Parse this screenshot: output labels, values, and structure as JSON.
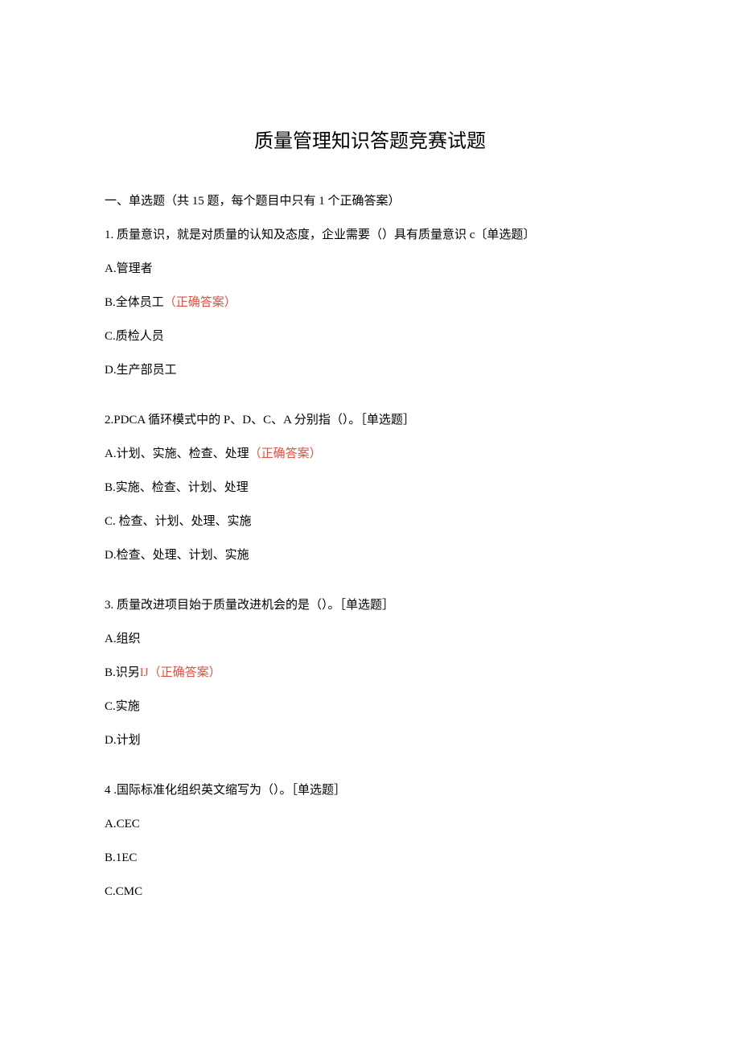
{
  "title": "质量管理知识答题竞赛试题",
  "section_header": "一、单选题（共 15 题，每个题目中只有 1 个正确答案）",
  "questions": [
    {
      "stem": "1. 质量意识，就是对质量的认知及态度，企业需要（）具有质量意识 c〔单选题〕",
      "options": [
        {
          "label": "A.管理者",
          "correct": false
        },
        {
          "label": "B.全体员工",
          "correct": true,
          "suffix": "（正确答案）"
        },
        {
          "label": "C.质检人员",
          "correct": false
        },
        {
          "label": "D.生产部员工",
          "correct": false
        }
      ]
    },
    {
      "stem": "2.PDCA 循环模式中的 P、D、C、A 分别指（）。［单选题］",
      "options": [
        {
          "label": "A.计划、实施、检查、处理",
          "correct": true,
          "suffix": "（正确答案）"
        },
        {
          "label": "B.实施、检查、计划、处理",
          "correct": false
        },
        {
          "label": "C. 检查、计划、处理、实施",
          "correct": false
        },
        {
          "label": "D.检查、处理、计划、实施",
          "correct": false
        }
      ]
    },
    {
      "stem": "3. 质量改进项目始于质量改进机会的是（）。［单选题］",
      "options": [
        {
          "label": "A.组织",
          "correct": false
        },
        {
          "label": "B.识另",
          "correct": true,
          "inline_red": "IJ",
          "suffix": "（正确答案）"
        },
        {
          "label": "C.实施",
          "correct": false
        },
        {
          "label": "D.计划",
          "correct": false
        }
      ]
    },
    {
      "stem": "4 .国际标准化组织英文缩写为（）。［单选题］",
      "options": [
        {
          "label": "A.CEC",
          "correct": false
        },
        {
          "label": "B.1EC",
          "correct": false
        },
        {
          "label": "C.CMC",
          "correct": false
        }
      ]
    }
  ]
}
